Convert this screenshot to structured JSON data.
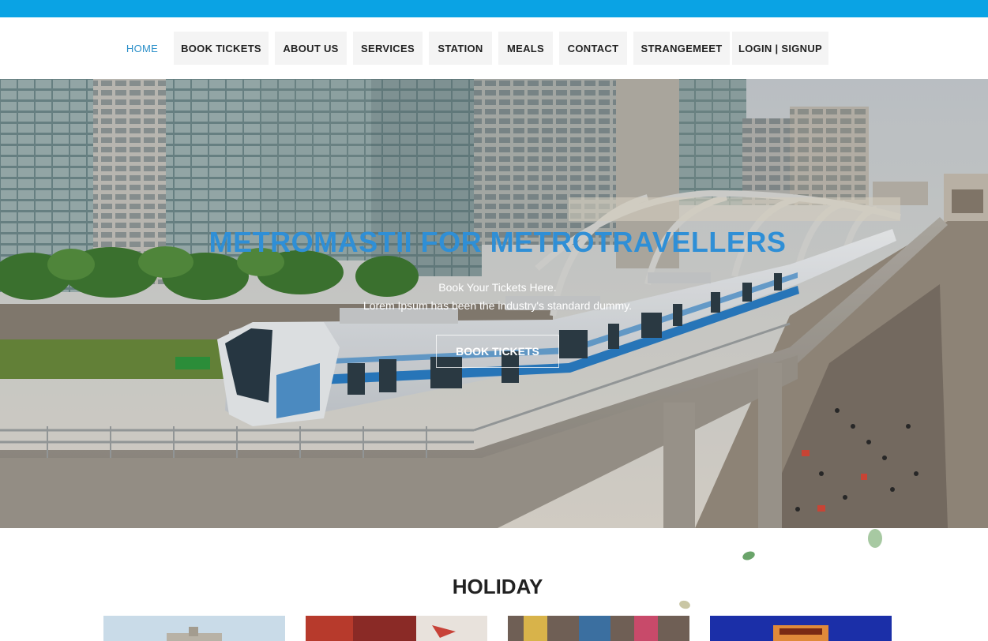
{
  "nav": {
    "items": [
      {
        "label": "HOME"
      },
      {
        "label": "BOOK TICKETS"
      },
      {
        "label": "ABOUT US"
      },
      {
        "label": "SERVICES"
      },
      {
        "label": "STATION"
      },
      {
        "label": "MEALS"
      },
      {
        "label": "CONTACT"
      },
      {
        "label": "STRANGEMEET"
      },
      {
        "label": "LOGIN | SIGNUP"
      }
    ]
  },
  "hero": {
    "title": "METROMASTII FOR METROTRAVELLERS",
    "subtitle": "Book Your Tickets Here.",
    "description": "Lorem Ipsum has been the industry's standard dummy.",
    "button_label": "BOOK TICKETS"
  },
  "section": {
    "title": "HOLIDAY"
  },
  "colors": {
    "top_strip": "#0aa3e4",
    "nav_active": "#2a8fc9",
    "hero_title": "#2f8fd6"
  }
}
